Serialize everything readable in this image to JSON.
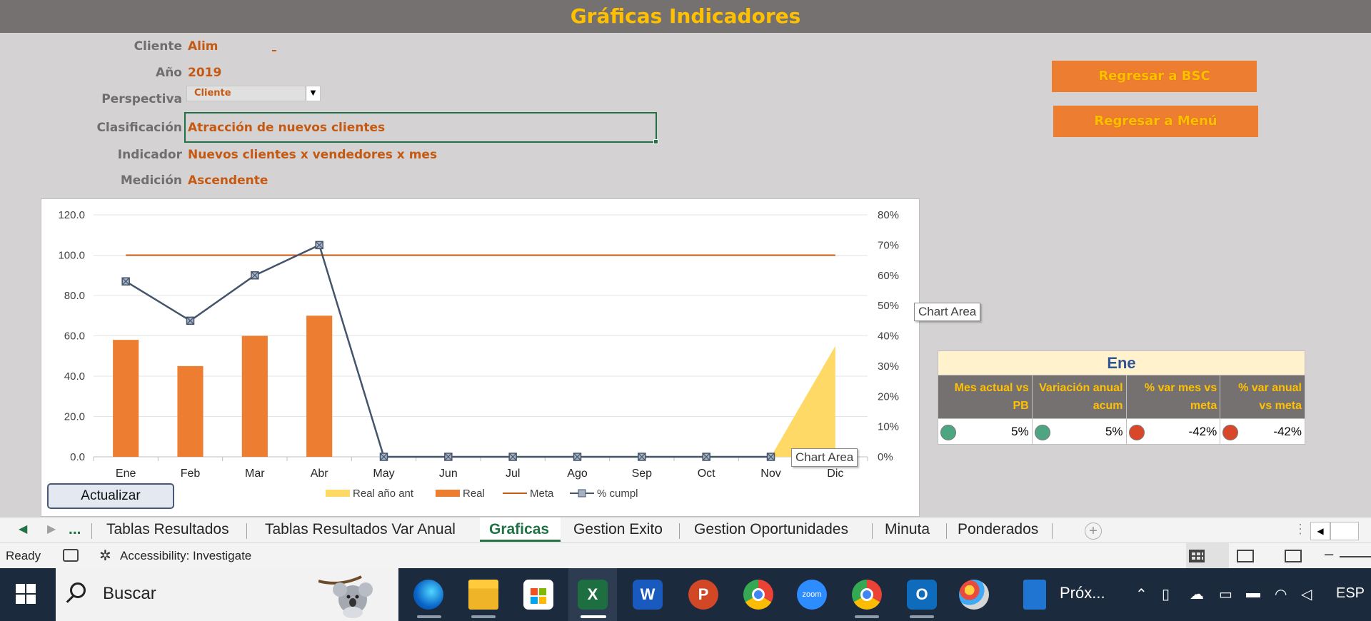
{
  "page": {
    "title": "Gráficas Indicadores"
  },
  "form": {
    "cliente_label": "Cliente",
    "cliente_value": "Alim",
    "anio_label": "Año",
    "anio_value": "2019",
    "perspectiva_label": "Perspectiva",
    "perspectiva_value": "Cliente",
    "clasificacion_label": "Clasificación",
    "clasificacion_value": "Atracción de nuevos clientes",
    "indicador_label": "Indicador",
    "indicador_value": "Nuevos clientes x vendedores x mes",
    "medicion_label": "Medición",
    "medicion_value": "Ascendente"
  },
  "buttons": {
    "regresar_bsc": "Regresar a BSC",
    "regresar_menu": "Regresar a Menú",
    "actualizar": "Actualizar"
  },
  "tooltips": {
    "chart_area_1": "Chart Area",
    "chart_area_2": "Chart Area"
  },
  "chart_data": {
    "type": "bar",
    "categories": [
      "Ene",
      "Feb",
      "Mar",
      "Abr",
      "May",
      "Jun",
      "Jul",
      "Ago",
      "Sep",
      "Oct",
      "Nov",
      "Dic"
    ],
    "series": [
      {
        "name": "Real año ant",
        "kind": "area",
        "axis": "left",
        "values": [
          null,
          null,
          null,
          null,
          null,
          null,
          null,
          null,
          null,
          null,
          0,
          55
        ],
        "color": "#ffd966"
      },
      {
        "name": "Real",
        "kind": "bar",
        "axis": "left",
        "values": [
          58,
          45,
          60,
          70,
          null,
          null,
          null,
          null,
          null,
          null,
          null,
          null
        ],
        "color": "#ed7d31"
      },
      {
        "name": "Meta",
        "kind": "line",
        "axis": "left",
        "values": [
          100,
          100,
          100,
          100,
          100,
          100,
          100,
          100,
          100,
          100,
          100,
          100
        ],
        "color": "#c55a11"
      },
      {
        "name": "% cumpl",
        "kind": "line-marker",
        "axis": "right",
        "values": [
          58,
          45,
          60,
          70,
          0,
          0,
          0,
          0,
          0,
          0,
          0,
          null
        ],
        "color": "#44546a"
      }
    ],
    "y_left": {
      "min": 0,
      "max": 120,
      "ticks": [
        "0.0",
        "20.0",
        "40.0",
        "60.0",
        "80.0",
        "100.0",
        "120.0"
      ]
    },
    "y_right": {
      "min": 0,
      "max": 80,
      "ticks": [
        "0%",
        "10%",
        "20%",
        "30%",
        "40%",
        "50%",
        "60%",
        "70%",
        "80%"
      ]
    },
    "grid": true,
    "legend": "bottom"
  },
  "kpi": {
    "month": "Ene",
    "headers": [
      "Mes actual vs PB",
      "Variación anual acum",
      "% var mes vs meta",
      "% var anual vs meta"
    ],
    "values": [
      "5%",
      "5%",
      "-42%",
      "-42%"
    ],
    "status_colors": [
      "#4ea582",
      "#4ea582",
      "#d9472b",
      "#d9472b"
    ]
  },
  "sheet_tabs": {
    "ellipsis": "...",
    "items": [
      "Tablas Resultados",
      "Tablas Resultados Var Anual",
      "Graficas",
      "Gestion Exito",
      "Gestion Oportunidades",
      "Minuta",
      "Ponderados"
    ],
    "active": "Graficas"
  },
  "status": {
    "ready": "Ready",
    "accessibility": "Accessibility: Investigate"
  },
  "taskbar": {
    "search_text": "Buscar",
    "apps": [
      "edge-icon",
      "file-explorer-icon",
      "store-icon",
      "excel-icon",
      "word-icon",
      "powerpoint-icon",
      "chrome-icon",
      "zoom-icon",
      "chrome-profile-icon",
      "outlook-icon",
      "paint-icon"
    ],
    "calendar_text": "Próx...",
    "language": "ESP",
    "zoom_app_label": "zoom"
  }
}
